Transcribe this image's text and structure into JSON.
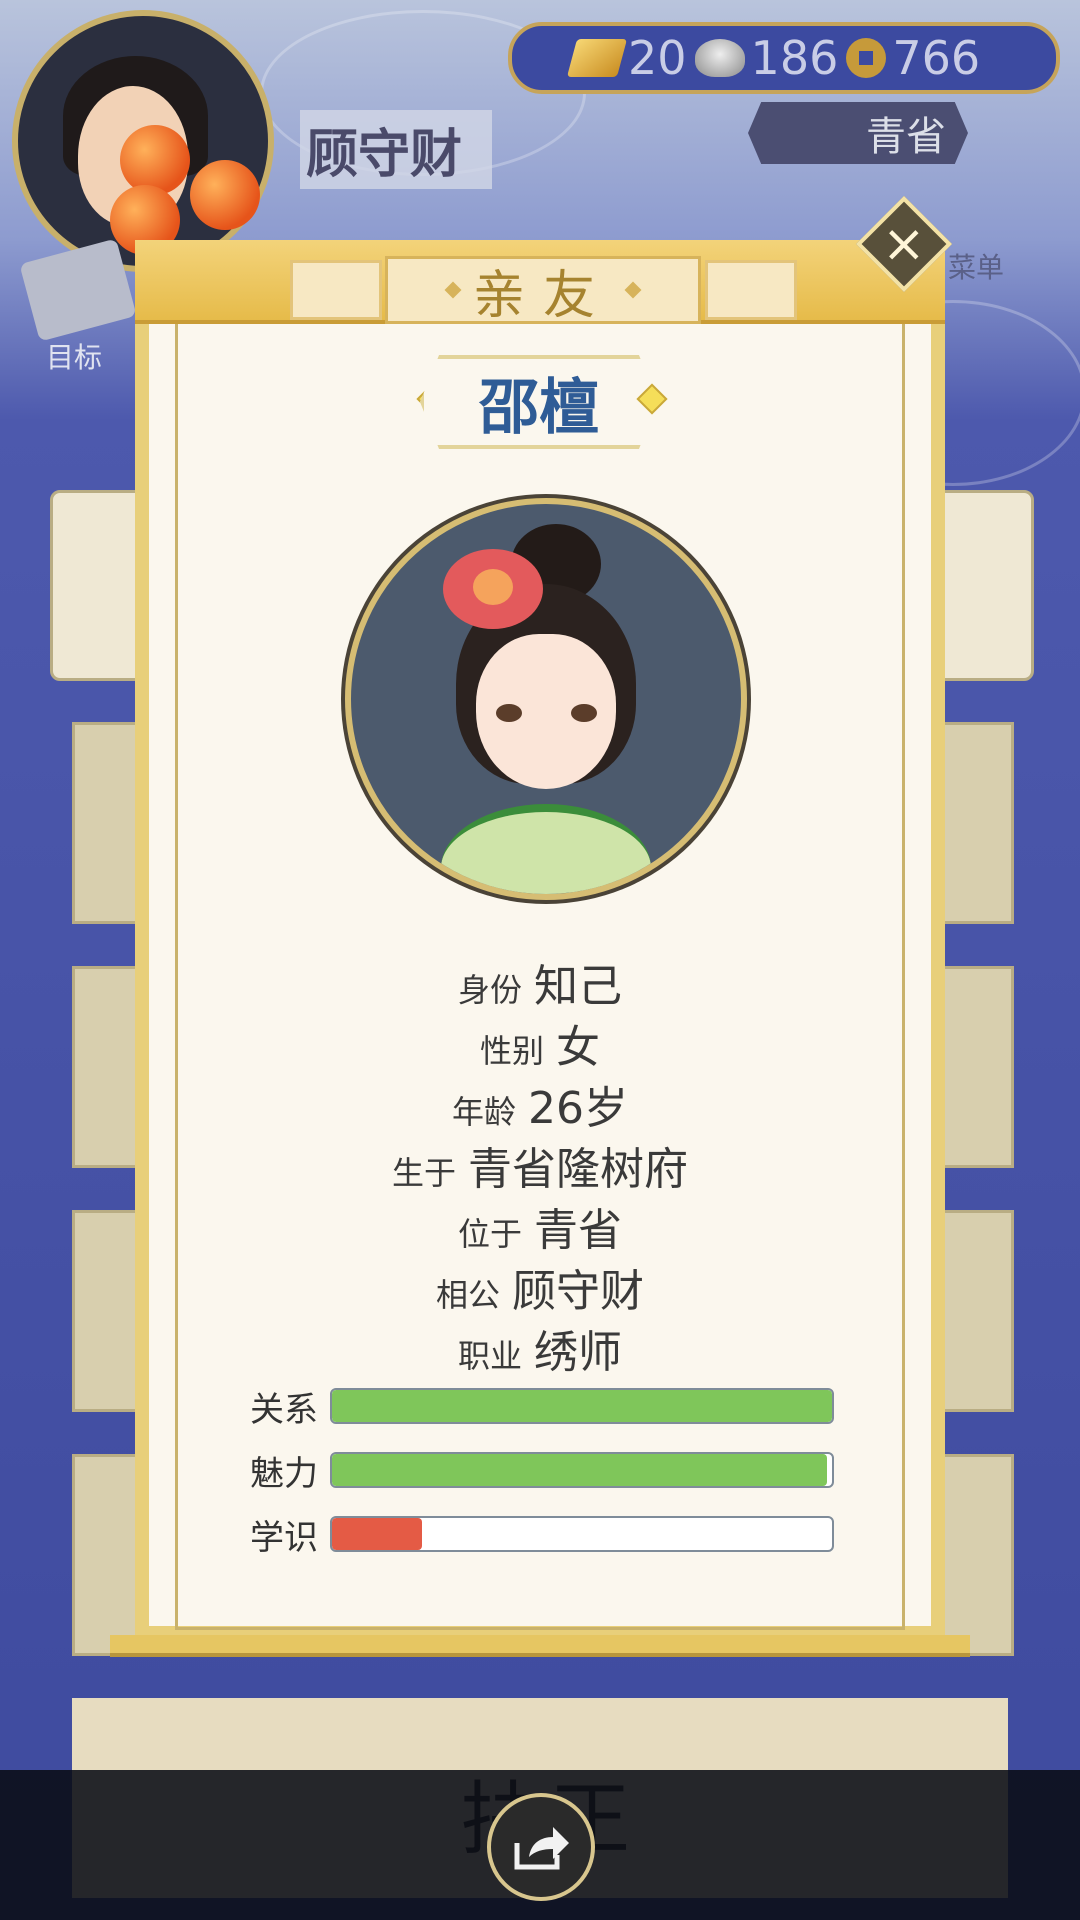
{
  "player": {
    "name": "顾守财"
  },
  "currency": {
    "gold": "20",
    "silver": "186",
    "copper": "766"
  },
  "region": {
    "label": "青省"
  },
  "hud": {
    "menu_label": "菜单",
    "goal_label": "目标"
  },
  "bottom_card": {
    "text": "扶正"
  },
  "modal": {
    "title": "亲友",
    "close_glyph": "×",
    "character_name": "邵檀",
    "info": [
      {
        "key": "身份",
        "value": "知己"
      },
      {
        "key": "性别",
        "value": "女"
      },
      {
        "key": "年龄",
        "value": "26岁"
      },
      {
        "key": "生于",
        "value": "青省隆树府"
      },
      {
        "key": "位于",
        "value": "青省"
      },
      {
        "key": "相公",
        "value": "顾守财"
      },
      {
        "key": "职业",
        "value": "绣师"
      }
    ],
    "stats": [
      {
        "label": "关系",
        "level": 1.0,
        "color": "#7fc65a"
      },
      {
        "label": "魅力",
        "level": 0.99,
        "color": "#7fc65a"
      },
      {
        "label": "学识",
        "level": 0.18,
        "color": "#e45b45"
      }
    ]
  },
  "icons": [
    "gold-ingot-icon",
    "silver-ingot-icon",
    "copper-coin-icon",
    "close-icon",
    "share-icon",
    "ink-stone-icon",
    "goal-scroll-icon"
  ]
}
